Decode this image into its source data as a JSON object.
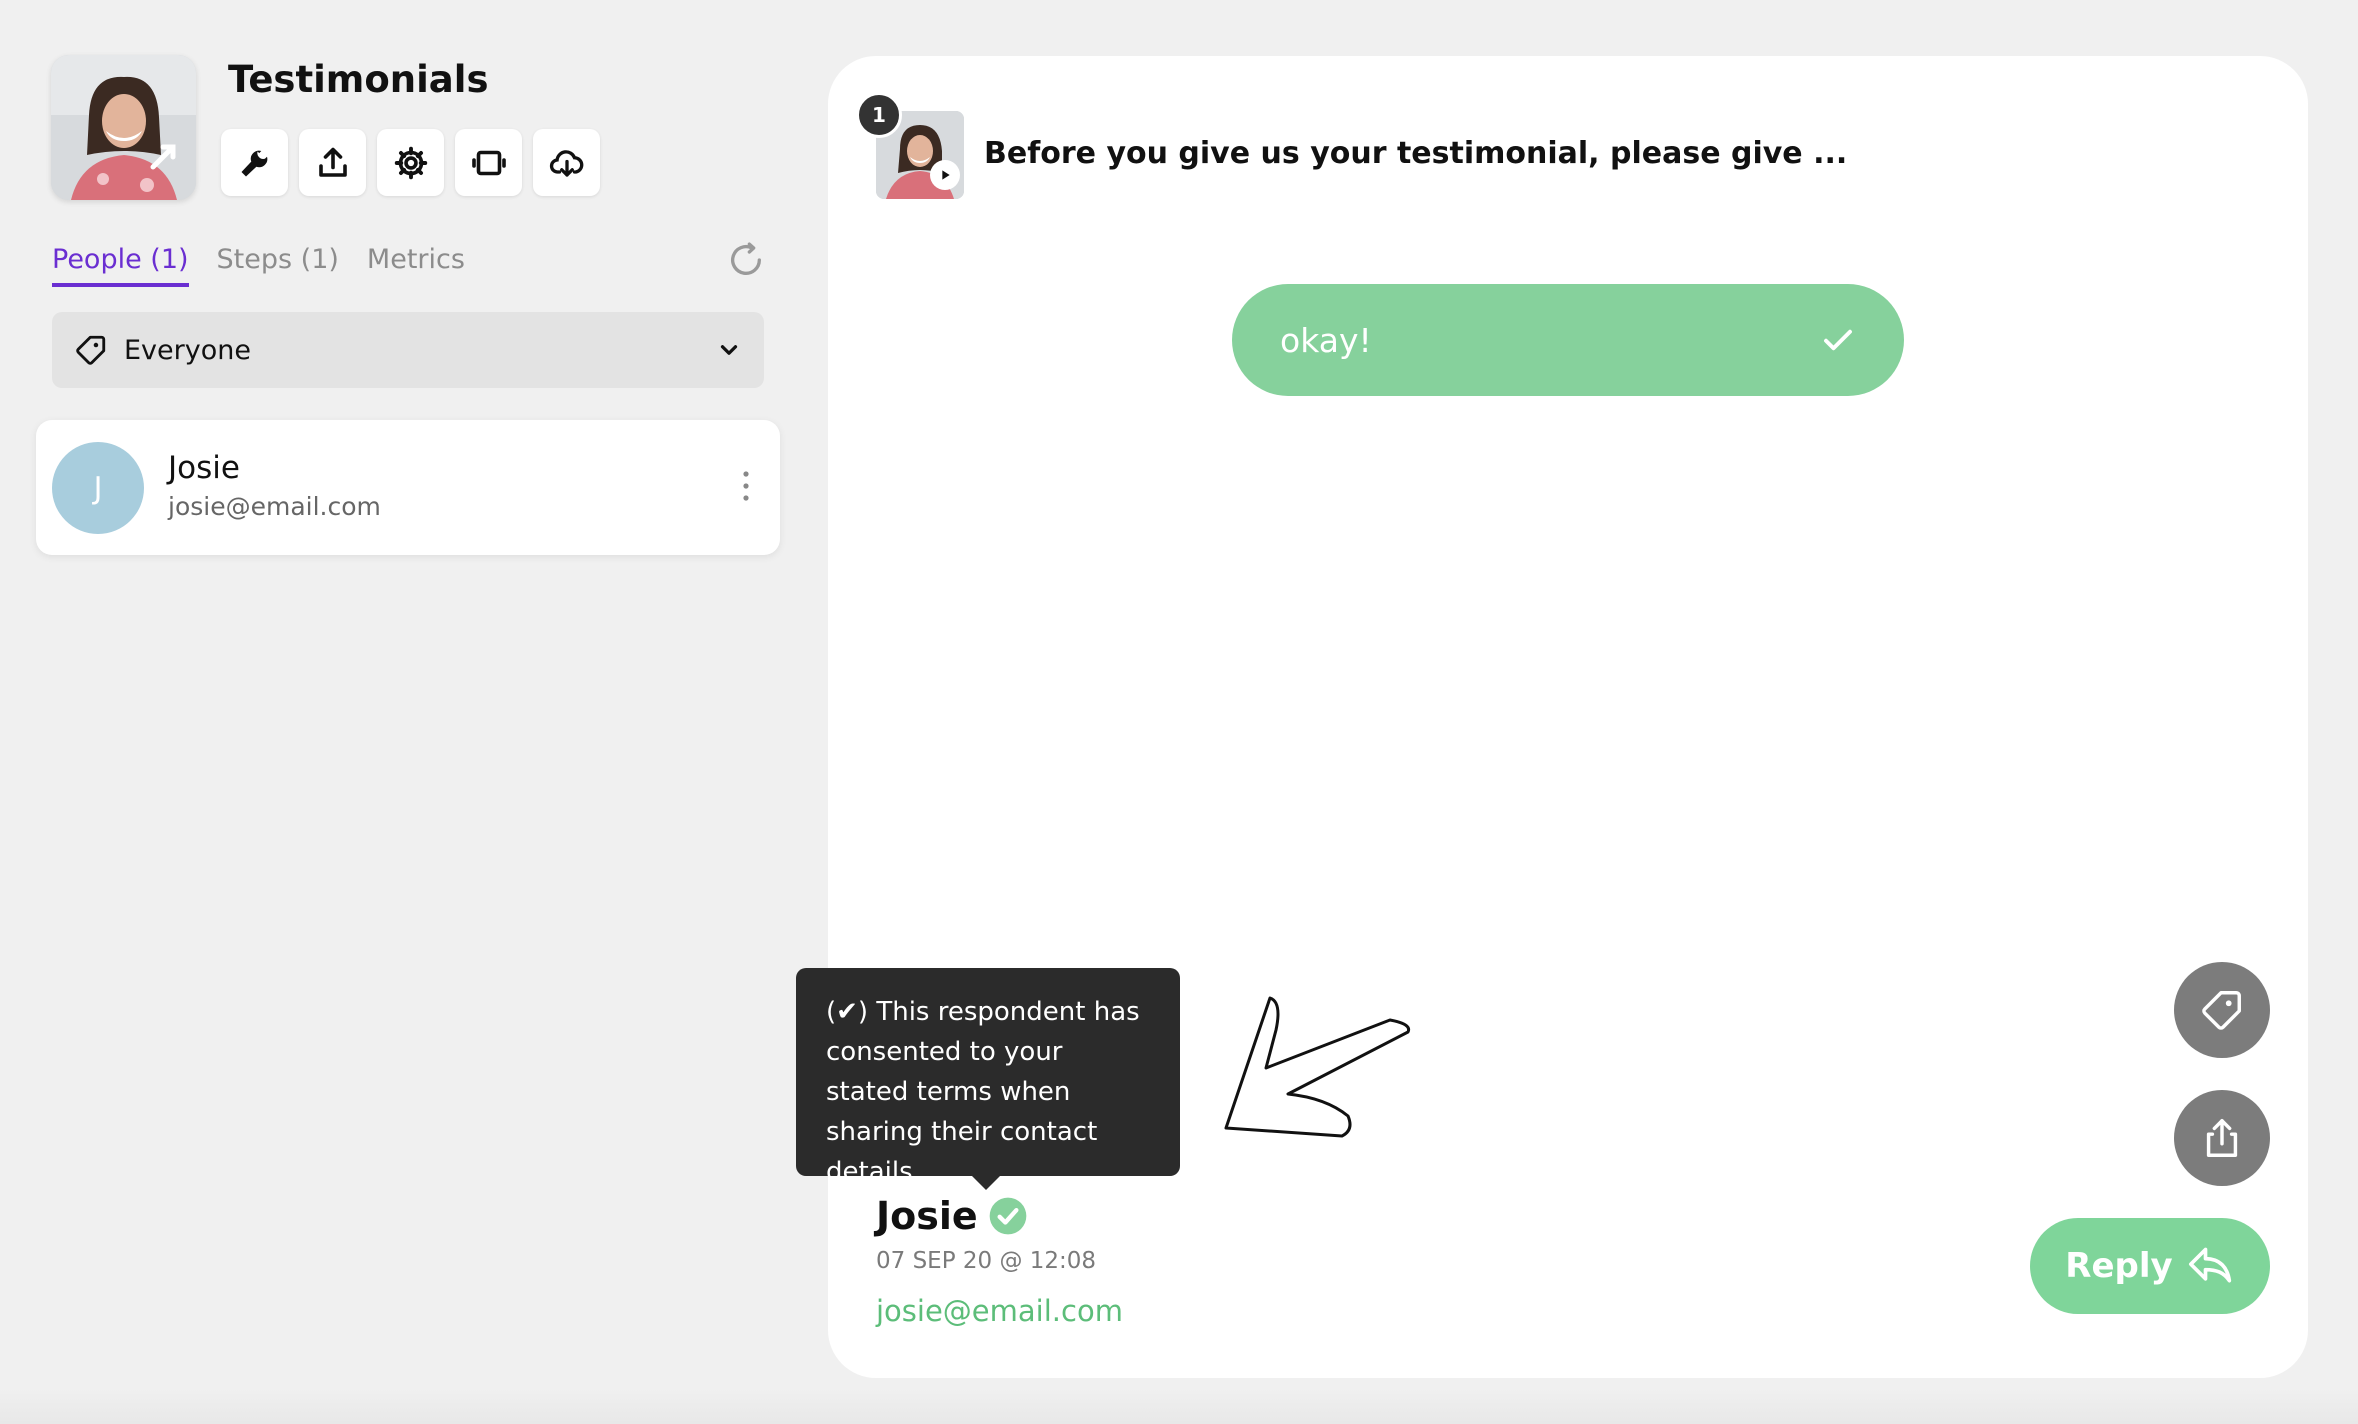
{
  "app": {
    "title": "Testimonials"
  },
  "toolbar": {
    "buttons": [
      {
        "name": "wrench-icon"
      },
      {
        "name": "upload-icon"
      },
      {
        "name": "gear-icon"
      },
      {
        "name": "embed-icon"
      },
      {
        "name": "cloud-download-icon"
      }
    ]
  },
  "tabs": [
    {
      "label": "People (1)",
      "active": true
    },
    {
      "label": "Steps (1)",
      "active": false
    },
    {
      "label": "Metrics",
      "active": false
    }
  ],
  "filter": {
    "label": "Everyone"
  },
  "people": [
    {
      "initial": "J",
      "name": "Josie",
      "email": "josie@email.com"
    }
  ],
  "step": {
    "number": "1",
    "text": "Before you give us your testimonial, please give ..."
  },
  "answer": {
    "text": "okay!"
  },
  "respondent": {
    "name": "Josie",
    "date": "07 SEP 20 @ 12:08",
    "email": "josie@email.com"
  },
  "tooltip": {
    "text": "(✔) This respondent has consented to your stated terms when sharing their contact details."
  },
  "actions": {
    "reply_label": "Reply"
  },
  "colors": {
    "accent_purple": "#6a2ed1",
    "green": "#86d19c",
    "green_text": "#5cbd79",
    "tooltip_bg": "#2b2b2b",
    "side_button": "#7c7c7c"
  }
}
